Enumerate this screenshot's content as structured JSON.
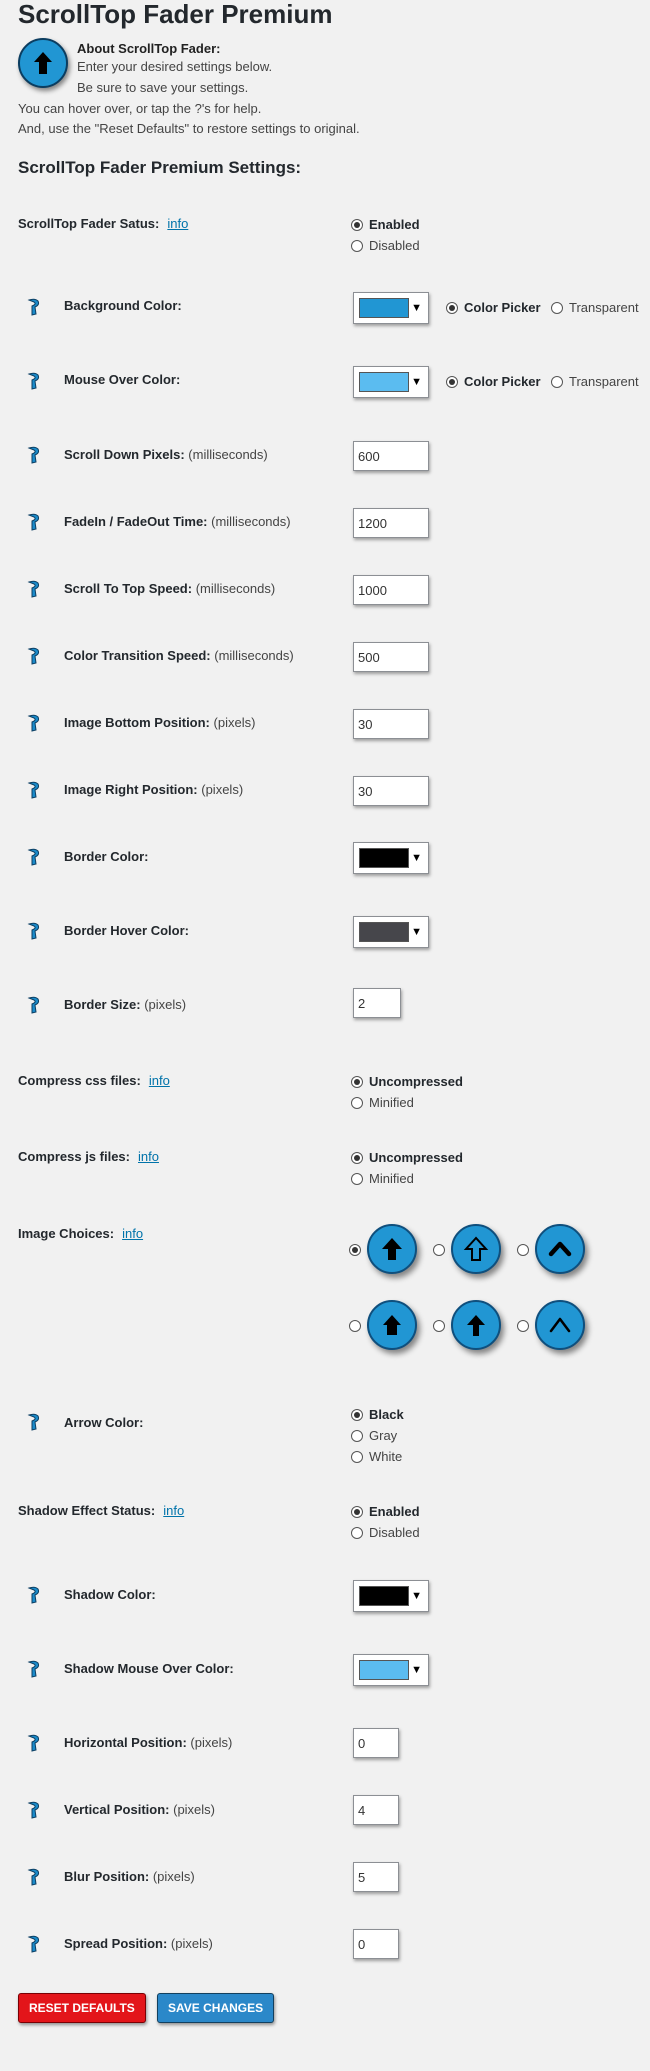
{
  "page": {
    "title": "ScrollTop Fader Premium",
    "about_heading": "About ScrollTop Fader:",
    "about_lines": [
      "Enter your desired settings below.",
      "Be sure to save your settings.",
      "You can hover over, or tap the ?'s for help.",
      "And, use the \"Reset Defaults\" to restore settings to original."
    ],
    "settings_title": "ScrollTop Fader Premium Settings:",
    "info_link": "info"
  },
  "colors": {
    "bg_blue": "#2196d3",
    "hover_light_blue": "#5bbcf0",
    "black": "#000000",
    "dark_gray": "#46464b",
    "reset_red": "#e3151a",
    "save_blue": "#2b88c9",
    "link_blue": "#0073aa"
  },
  "status": {
    "label": "ScrollTop Fader Satus:",
    "options": [
      "Enabled",
      "Disabled"
    ],
    "selected": "Enabled"
  },
  "background_color": {
    "label": "Background Color:",
    "swatch": "#2196d3",
    "options": [
      "Color Picker",
      "Transparent"
    ],
    "selected": "Color Picker"
  },
  "mouse_over_color": {
    "label": "Mouse Over Color:",
    "swatch": "#5bbcf0",
    "options": [
      "Color Picker",
      "Transparent"
    ],
    "selected": "Color Picker"
  },
  "unit_ms": "(milliseconds)",
  "unit_px": "(pixels)",
  "scroll_down_pixels": {
    "label": "Scroll Down Pixels:",
    "value": "600"
  },
  "fade_time": {
    "label": "FadeIn / FadeOut Time:",
    "value": "1200"
  },
  "scroll_speed": {
    "label": "Scroll To Top Speed:",
    "value": "1000"
  },
  "transition_speed": {
    "label": "Color Transition Speed:",
    "value": "500"
  },
  "image_bottom": {
    "label": "Image Bottom Position:",
    "value": "30"
  },
  "image_right": {
    "label": "Image Right Position:",
    "value": "30"
  },
  "border_color": {
    "label": "Border Color:",
    "swatch": "#000000"
  },
  "border_hover_color": {
    "label": "Border Hover Color:",
    "swatch": "#46464b"
  },
  "border_size": {
    "label": "Border Size:",
    "value": "2"
  },
  "compress_css": {
    "label": "Compress css files:",
    "options": [
      "Uncompressed",
      "Minified"
    ],
    "selected": "Uncompressed"
  },
  "compress_js": {
    "label": "Compress js files:",
    "options": [
      "Uncompressed",
      "Minified"
    ],
    "selected": "Uncompressed"
  },
  "image_choices": {
    "label": "Image Choices:",
    "icons": [
      "arrow-up-icon",
      "outline-arrow-up-icon",
      "caret-up-icon",
      "house-arrow-up-icon",
      "thin-arrow-up-icon",
      "chevron-up-icon"
    ],
    "selected_index": 0
  },
  "arrow_color": {
    "label": "Arrow Color:",
    "options": [
      "Black",
      "Gray",
      "White"
    ],
    "selected": "Black"
  },
  "shadow_status": {
    "label": "Shadow Effect Status:",
    "options": [
      "Enabled",
      "Disabled"
    ],
    "selected": "Enabled"
  },
  "shadow_color": {
    "label": "Shadow Color:",
    "swatch": "#000000"
  },
  "shadow_hover_color": {
    "label": "Shadow Mouse Over Color:",
    "swatch": "#5bbcf0"
  },
  "horizontal_position": {
    "label": "Horizontal Position:",
    "value": "0"
  },
  "vertical_position": {
    "label": "Vertical Position:",
    "value": "4"
  },
  "blur_position": {
    "label": "Blur Position:",
    "value": "5"
  },
  "spread_position": {
    "label": "Spread Position:",
    "value": "0"
  },
  "buttons": {
    "reset": "Reset Defaults",
    "save": "Save Changes"
  }
}
